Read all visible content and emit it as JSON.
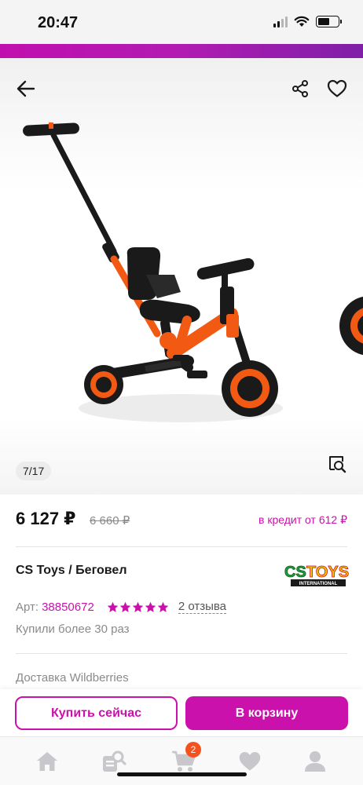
{
  "status_bar": {
    "time": "20:47",
    "icons": [
      "signal-icon",
      "wifi-icon",
      "battery-icon"
    ],
    "battery_level": 0.6
  },
  "header": {
    "icons": [
      "arrow-left-icon",
      "share-icon",
      "heart-icon"
    ]
  },
  "gallery": {
    "counter": "7/17",
    "image": "orange-black-kids-tricycle-with-push-handle",
    "zoom_icon": "zoom-search-icon"
  },
  "product": {
    "price": "6 127 ₽",
    "old_price": "6 660 ₽",
    "credit": "в кредит от 612 ₽",
    "title": "CS Toys / Беговел",
    "brand_logo_text": "CS TOYS",
    "brand_logo_subtext": "INTERNATIONAL",
    "article_label": "Арт:",
    "article_number": "38850672",
    "rating": 5,
    "reviews": "2 отзыва",
    "bought": "Купили более 30 раз",
    "delivery": "Доставка Wildberries"
  },
  "actions": {
    "buy_now": "Купить сейчас",
    "add_to_cart": "В корзину"
  },
  "bottom_nav": {
    "items": [
      "home-icon",
      "catalog-search-icon",
      "cart-icon",
      "heart-icon",
      "profile-icon"
    ],
    "cart_badge": "2"
  },
  "colors": {
    "accent": "#cb11ab",
    "badge": "#f5511e",
    "product_orange": "#f25a14"
  }
}
